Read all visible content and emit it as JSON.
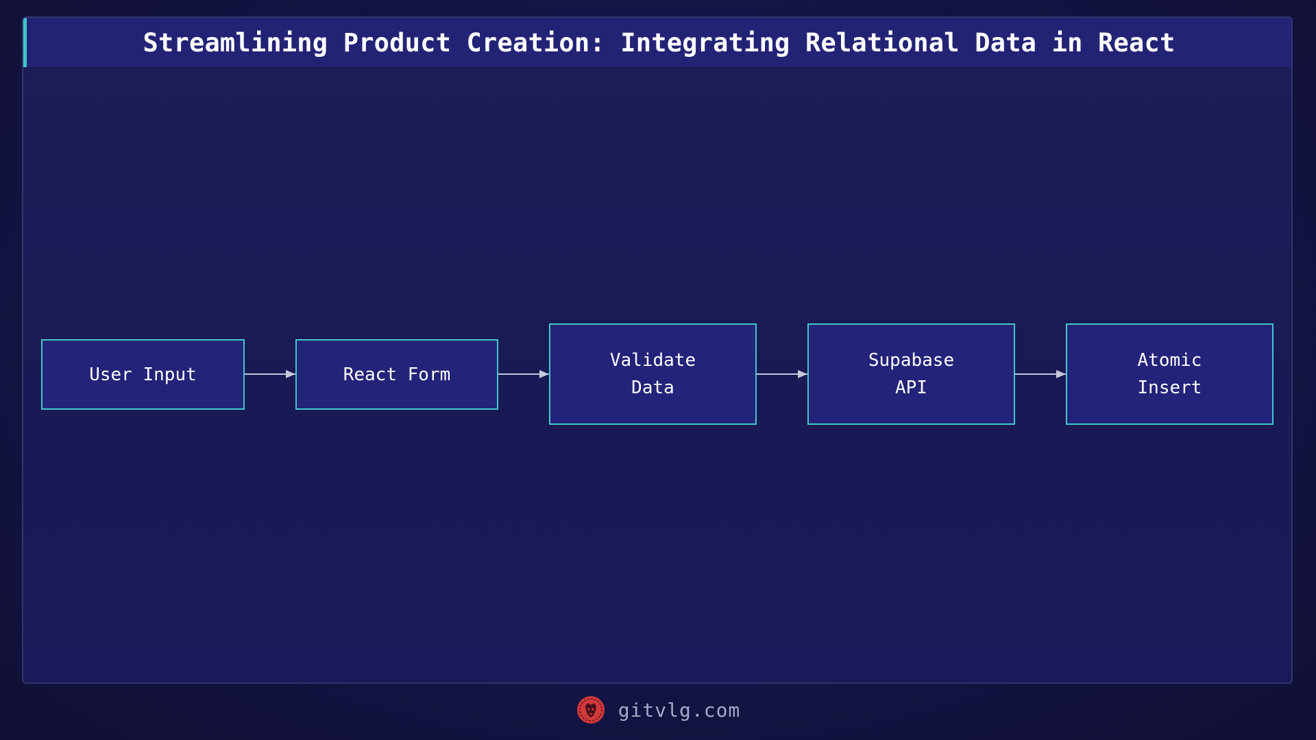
{
  "title": "Streamlining Product Creation: Integrating Relational Data in React",
  "diagram": {
    "nodes": [
      {
        "id": "user-input",
        "label": "User Input"
      },
      {
        "id": "react-form",
        "label": "React Form"
      },
      {
        "id": "validate-data",
        "label": "Validate\nData"
      },
      {
        "id": "supabase-api",
        "label": "Supabase\nAPI"
      },
      {
        "id": "atomic-insert",
        "label": "Atomic\nInsert"
      }
    ],
    "edges": [
      {
        "from": "user-input",
        "to": "react-form"
      },
      {
        "from": "react-form",
        "to": "validate-data"
      },
      {
        "from": "validate-data",
        "to": "supabase-api"
      },
      {
        "from": "supabase-api",
        "to": "atomic-insert"
      }
    ]
  },
  "footer": {
    "brand": "gitvlg.com",
    "logo_icon": "lion-logo-icon"
  },
  "colors": {
    "background": "#15154a",
    "title_bar": "#232376",
    "accent": "#40c9c9",
    "node_fill": "#23237a",
    "arrow": "#c8c8dc",
    "logo": "#d23a3a"
  }
}
